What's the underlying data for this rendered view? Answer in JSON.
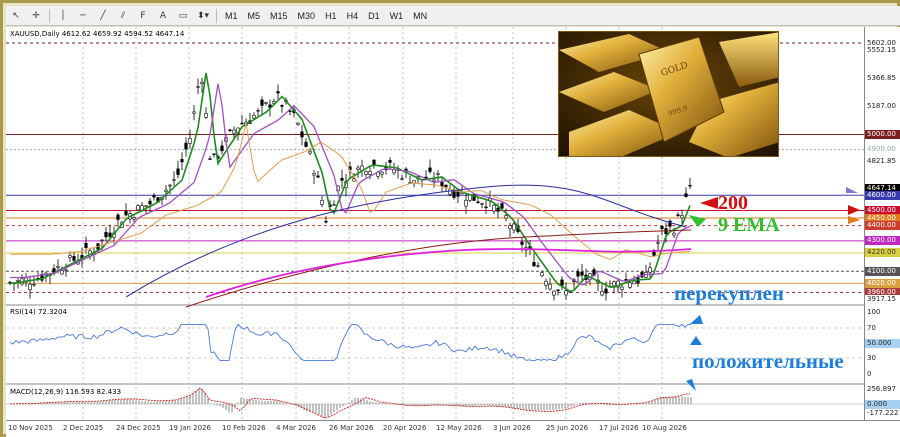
{
  "toolbar": {
    "timeframes": [
      "M1",
      "M5",
      "M15",
      "M30",
      "H1",
      "H4",
      "D1",
      "W1",
      "MN"
    ]
  },
  "chart_title": "XAUUSD,Daily  4612.62 4659.92 4594.52 4647.14",
  "rsi_label": "RSI(14) 72.3204",
  "macd_label": "MACD(12,26,9) 116.593 82.433",
  "gold_image_text": [
    "GOLD",
    "999.9"
  ],
  "price_levels": [
    {
      "label": "5602.00",
      "bg": "#ffffff",
      "fg": "#222",
      "value": 5602
    },
    {
      "label": "5552.15",
      "bg": "#ffffff",
      "fg": "#222",
      "value": 5552.15
    },
    {
      "label": "5366.85",
      "bg": "#ffffff",
      "fg": "#222",
      "value": 5366.85
    },
    {
      "label": "5187.00",
      "bg": "#ffffff",
      "fg": "#222",
      "value": 5187
    },
    {
      "label": "5000.00",
      "bg": "#7a1f1f",
      "fg": "#fff",
      "value": 5000
    },
    {
      "label": "4900.00",
      "bg": "#ffffff",
      "fg": "#9aa",
      "value": 4900
    },
    {
      "label": "4821.85",
      "bg": "#ffffff",
      "fg": "#222",
      "value": 4821.85
    },
    {
      "label": "4647.14",
      "bg": "#000000",
      "fg": "#fff",
      "value": 4647.14
    },
    {
      "label": "4600.00",
      "bg": "#3a3ab0",
      "fg": "#fff",
      "value": 4600
    },
    {
      "label": "4500.00",
      "bg": "#c8102e",
      "fg": "#fff",
      "value": 4500
    },
    {
      "label": "4450.00",
      "bg": "#e07a1a",
      "fg": "#fff",
      "value": 4450
    },
    {
      "label": "4400.00",
      "bg": "#cc3d2e",
      "fg": "#fff",
      "value": 4400
    },
    {
      "label": "4300.00",
      "bg": "#c026c0",
      "fg": "#fff",
      "value": 4300
    },
    {
      "label": "4220.00",
      "bg": "#d9d040",
      "fg": "#333",
      "value": 4220
    },
    {
      "label": "4100.00",
      "bg": "#555555",
      "fg": "#fff",
      "value": 4100
    },
    {
      "label": "4020.00",
      "bg": "#d9a040",
      "fg": "#fff",
      "value": 4020
    },
    {
      "label": "3960.00",
      "bg": "#a83a3a",
      "fg": "#fff",
      "value": 3960
    },
    {
      "label": "3917.15",
      "bg": "#ffffff",
      "fg": "#222",
      "value": 3917.15
    }
  ],
  "rsi_scale": [
    "100",
    "70",
    "50.000",
    "30",
    "0"
  ],
  "macd_scale": [
    "256.897",
    "0.000",
    "-177.222"
  ],
  "dates": [
    "10 Nov 2025",
    "2 Dec 2025",
    "24 Dec 2025",
    "19 Jan 2026",
    "10 Feb 2026",
    "4 Mar 2026",
    "26 Mar 2026",
    "20 Apr 2026",
    "12 May 2026",
    "3 Jun 2026",
    "25 Jun 2026",
    "17 Jul 2026",
    "10 Aug 2026"
  ],
  "annotations": {
    "ma200": "200",
    "ema9": "9 EMA",
    "overbought": "перекуплен",
    "positive": "положительные"
  },
  "colors": {
    "candles": "#000000",
    "ema9": "#1f8a1f",
    "ma_purple": "#a050c0",
    "ma_blue": "#2a2aa0",
    "ma_orange": "#e0a050",
    "ma200": "#8b1a1a",
    "pink_line": "#e020e0",
    "annotation_red": "#d01010",
    "annotation_green": "#30c030",
    "annotation_blue": "#1c7ed6",
    "rsi_line": "#4a7ad8"
  }
}
